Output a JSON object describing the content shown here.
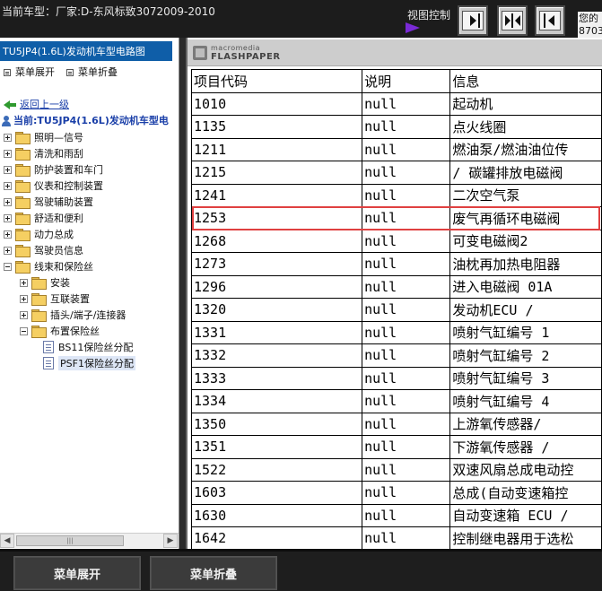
{
  "header": {
    "title": "当前车型：厂家:D-东风标致3072009-2010",
    "view_control_label": "视图控制",
    "right_text_line1": "您的",
    "right_text_line2": "8703"
  },
  "left_panel": {
    "title": "TU5JP4(1.6L)发动机车型电路图",
    "expand_label": "菜单展开",
    "collapse_label": "菜单折叠",
    "back_label": "返回上一级",
    "current_label": "当前:TU5JP4(1.6L)发动机车型电",
    "tree": [
      {
        "label": "照明—信号",
        "level": 0,
        "expander": "plus",
        "icon": "folder"
      },
      {
        "label": "清洗和雨刮",
        "level": 0,
        "expander": "plus",
        "icon": "folder"
      },
      {
        "label": "防护装置和车门",
        "level": 0,
        "expander": "plus",
        "icon": "folder"
      },
      {
        "label": "仪表和控制装置",
        "level": 0,
        "expander": "plus",
        "icon": "folder"
      },
      {
        "label": "驾驶辅助装置",
        "level": 0,
        "expander": "plus",
        "icon": "folder"
      },
      {
        "label": "舒适和便利",
        "level": 0,
        "expander": "plus",
        "icon": "folder"
      },
      {
        "label": "动力总成",
        "level": 0,
        "expander": "plus",
        "icon": "folder"
      },
      {
        "label": "驾驶员信息",
        "level": 0,
        "expander": "plus",
        "icon": "folder"
      },
      {
        "label": "线束和保险丝",
        "level": 0,
        "expander": "minus",
        "icon": "folder"
      },
      {
        "label": "安装",
        "level": 1,
        "expander": "plus",
        "icon": "folder"
      },
      {
        "label": "互联装置",
        "level": 1,
        "expander": "plus",
        "icon": "folder"
      },
      {
        "label": "插头/端子/连接器",
        "level": 1,
        "expander": "plus",
        "icon": "folder"
      },
      {
        "label": "布置保险丝",
        "level": 1,
        "expander": "minus",
        "icon": "folder"
      },
      {
        "label": "BS11保险丝分配",
        "level": 2,
        "expander": "none",
        "icon": "doc"
      },
      {
        "label": "PSF1保险丝分配",
        "level": 2,
        "expander": "none",
        "icon": "doc",
        "selected": true
      }
    ]
  },
  "document": {
    "brand_small": "macromedia",
    "brand_large": "FLASHPAPER",
    "columns": [
      "项目代码",
      "说明",
      "信息"
    ],
    "rows": [
      [
        "1010",
        "null",
        "起动机"
      ],
      [
        "1135",
        "null",
        "点火线圈"
      ],
      [
        "1211",
        "null",
        "燃油泵/燃油油位传"
      ],
      [
        "1215",
        "null",
        "/ 碳罐排放电磁阀"
      ],
      [
        "1241",
        "null",
        "二次空气泵"
      ],
      [
        "1253",
        "null",
        "废气再循环电磁阀"
      ],
      [
        "1268",
        "null",
        "可变电磁阀2"
      ],
      [
        "1273",
        "null",
        "油枕再加热电阻器"
      ],
      [
        "1296",
        "null",
        "进入电磁阀 01A"
      ],
      [
        "1320",
        "null",
        "发动机ECU /"
      ],
      [
        "1331",
        "null",
        "喷射气缸编号 1"
      ],
      [
        "1332",
        "null",
        "喷射气缸编号 2"
      ],
      [
        "1333",
        "null",
        "喷射气缸编号 3"
      ],
      [
        "1334",
        "null",
        "喷射气缸编号 4"
      ],
      [
        "1350",
        "null",
        "上游氧传感器/"
      ],
      [
        "1351",
        "null",
        "下游氧传感器 /"
      ],
      [
        "1522",
        "null",
        "双速风扇总成电动控"
      ],
      [
        "1603",
        "null",
        "总成(自动变速箱控"
      ],
      [
        "1630",
        "null",
        "自动变速箱 ECU /"
      ],
      [
        "1642",
        "null",
        "控制继电器用于选松"
      ]
    ],
    "highlighted_row": "1253"
  },
  "footer": {
    "expand_button": "菜单展开",
    "collapse_button": "菜单折叠"
  },
  "colors": {
    "panel_title_bg": "#0f5ea8",
    "highlight_border": "#e04040",
    "view_arrow": "#7a2ad6"
  }
}
